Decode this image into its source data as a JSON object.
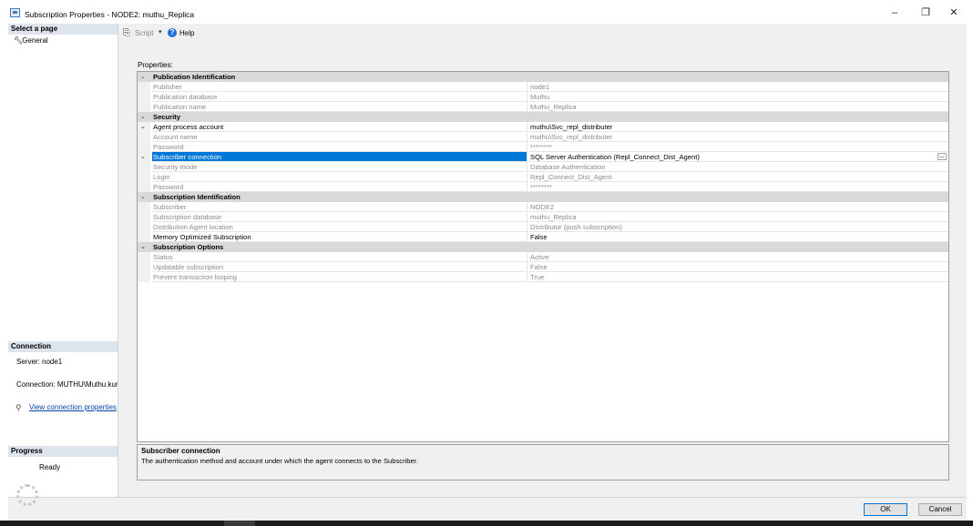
{
  "window": {
    "title": "Subscription Properties - NODE2: muthu_Replica",
    "minimize": "–",
    "maximize": "❐",
    "close": "✕"
  },
  "left": {
    "select_page": "Select a page",
    "pages": [
      {
        "label": "General",
        "icon": "wrench-icon"
      }
    ],
    "connection_header": "Connection",
    "server": "Server: node1",
    "connection": "Connection: MUTHU\\Muthu.kuma",
    "view_conn": "View connection properties",
    "progress_header": "Progress",
    "progress_status": "Ready"
  },
  "toolbar": {
    "script": "Script",
    "dropdown": "▾",
    "help": "Help"
  },
  "props_label": "Properties:",
  "grid": {
    "rows": [
      {
        "type": "cat",
        "label": "Publication Identification"
      },
      {
        "type": "ro",
        "name": "Publisher",
        "value": "node1"
      },
      {
        "type": "ro",
        "name": "Publication database",
        "value": "Muthu"
      },
      {
        "type": "ro",
        "name": "Publication name",
        "value": "Muthu_Replica"
      },
      {
        "type": "cat",
        "label": "Security"
      },
      {
        "type": "sub",
        "name": "Agent process account",
        "value": "muthu\\Svc_repl_distributer"
      },
      {
        "type": "ro-indent",
        "name": "Account name",
        "value": "muthu\\Svc_repl_distributer"
      },
      {
        "type": "ro-indent",
        "name": "Password",
        "value": "********"
      },
      {
        "type": "sel",
        "name": "Subscriber connection",
        "value": "SQL Server Authentication (Repl_Connect_Dist_Agent)"
      },
      {
        "type": "ro-indent",
        "name": "Security mode",
        "value": "Database Authentication"
      },
      {
        "type": "ro-indent",
        "name": "Login",
        "value": "Repl_Connect_Dist_Agent"
      },
      {
        "type": "ro-indent",
        "name": "Password",
        "value": "********"
      },
      {
        "type": "cat",
        "label": "Subscription Identification"
      },
      {
        "type": "ro",
        "name": "Subscriber",
        "value": "NODE2"
      },
      {
        "type": "ro",
        "name": "Subscription database",
        "value": "muthu_Replica"
      },
      {
        "type": "ro",
        "name": "Distribution Agent location",
        "value": "Distributor (push subscription)"
      },
      {
        "type": "rw",
        "name": "Memory Optimized Subscription",
        "value": "False"
      },
      {
        "type": "cat",
        "label": "Subscription Options"
      },
      {
        "type": "ro",
        "name": "Status",
        "value": "Active"
      },
      {
        "type": "ro",
        "name": "Updatable subscription",
        "value": "False"
      },
      {
        "type": "ro",
        "name": "Prevent transaction looping",
        "value": "True"
      }
    ],
    "ellipsis": "..."
  },
  "description": {
    "title": "Subscriber connection",
    "text": "The authentication method and account under which the agent connects to the Subscriber."
  },
  "buttons": {
    "ok": "OK",
    "cancel": "Cancel"
  }
}
